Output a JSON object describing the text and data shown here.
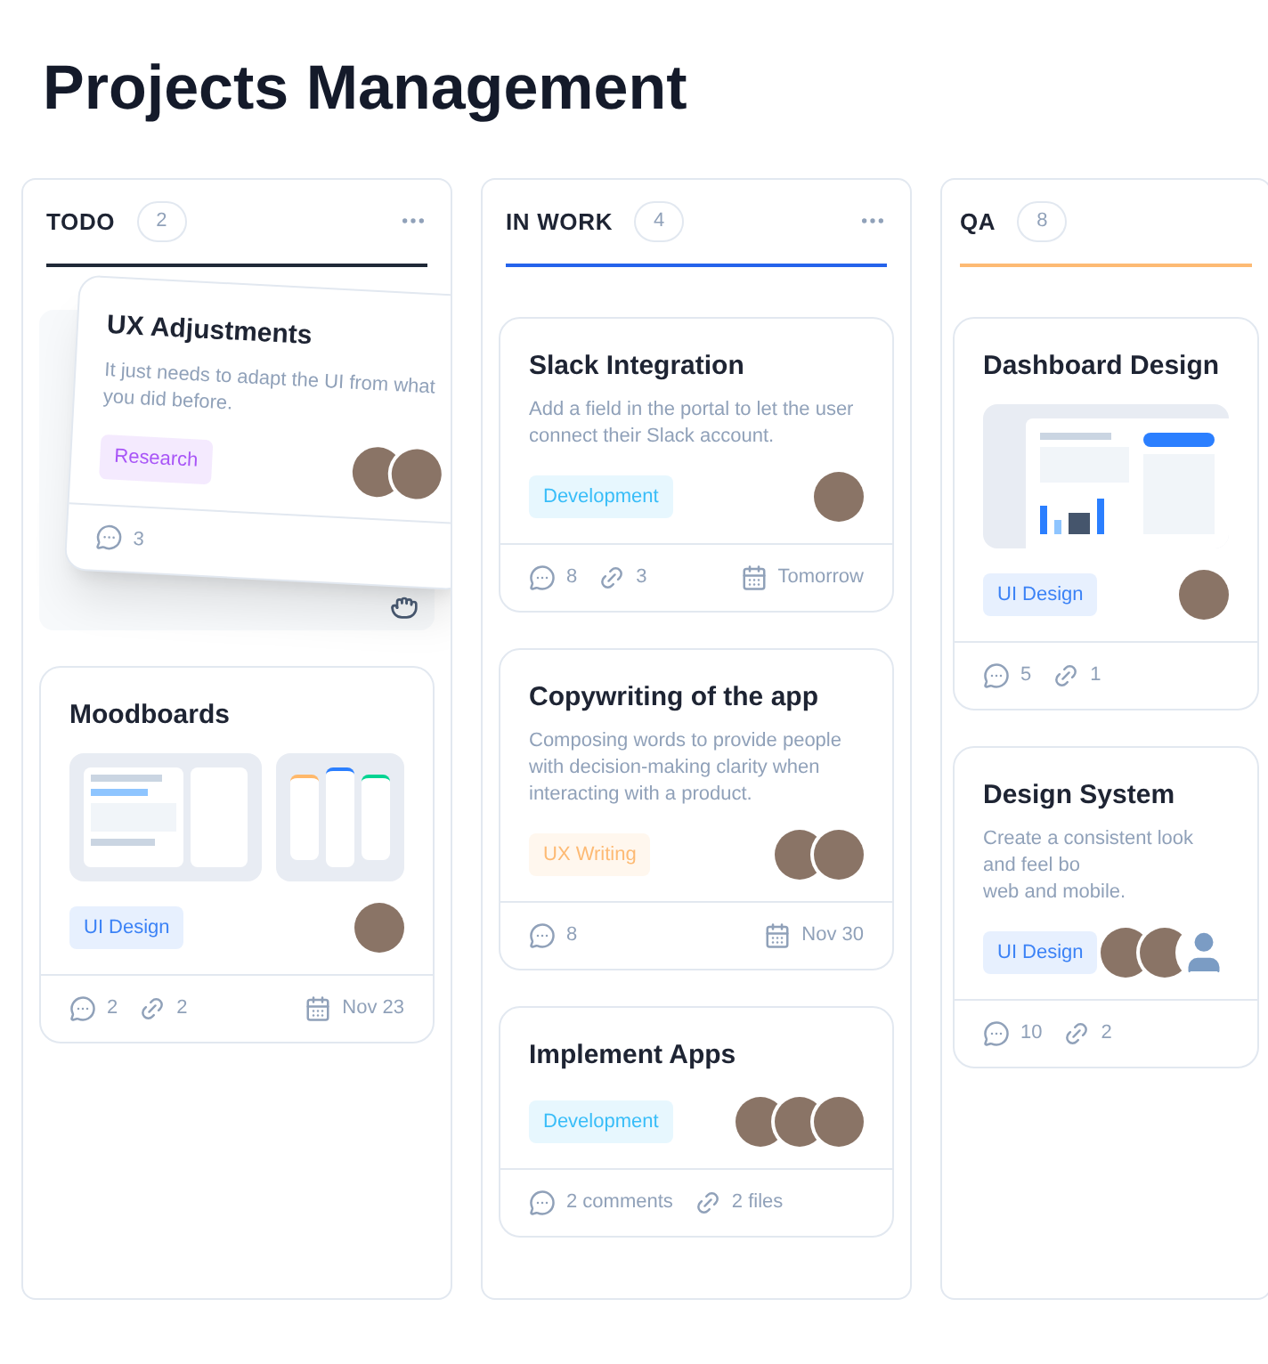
{
  "title": "Projects Management",
  "columns": [
    {
      "name": "TODO",
      "count": "2",
      "color": "#1f2937",
      "cards": [
        {
          "title": "UX Adjustments",
          "dragging": true,
          "description": [
            "It just needs to adapt the UI from what you did before."
          ],
          "tag": {
            "label": "Research",
            "color": "#a855f7"
          },
          "assignees": [
            {
              "kind": "photo"
            },
            {
              "kind": "photo"
            }
          ],
          "stats": [
            {
              "kind": "comments",
              "text": "3"
            }
          ]
        },
        {
          "title": "Moodboards",
          "dragging": false,
          "images": [
            {
              "kind": "desktop"
            },
            {
              "kind": "mobile"
            }
          ],
          "tag": {
            "label": "UI Design",
            "color": "#3b82f6"
          },
          "assignees": [
            {
              "kind": "photo"
            }
          ],
          "stats": [
            {
              "kind": "comments",
              "text": "2"
            },
            {
              "kind": "files",
              "text": "2"
            },
            {
              "kind": "due",
              "text": "Nov 23"
            }
          ]
        }
      ]
    },
    {
      "name": "IN WORK",
      "count": "4",
      "color": "#2563eb",
      "cards": [
        {
          "title": "Slack Integration",
          "dragging": false,
          "description": [
            "Add a field in the portal to let the user connect their Slack account."
          ],
          "tag": {
            "label": "Development",
            "color": "#38bdf8"
          },
          "assignees": [
            {
              "kind": "photo"
            }
          ],
          "stats": [
            {
              "kind": "comments",
              "text": "8"
            },
            {
              "kind": "files",
              "text": "3"
            },
            {
              "kind": "due",
              "text": "Tomorrow"
            }
          ]
        },
        {
          "title": "Copywriting of the app",
          "dragging": false,
          "description": [
            "Composing words to provide people with decision-making clarity when interacting with a product."
          ],
          "tag": {
            "label": "UX Writing",
            "color": "#fdba74"
          },
          "assignees": [
            {
              "kind": "photo"
            },
            {
              "kind": "photo"
            }
          ],
          "stats": [
            {
              "kind": "comments",
              "text": "8"
            },
            {
              "kind": "due",
              "text": "Nov 30"
            }
          ]
        },
        {
          "title": "Implement Apps",
          "dragging": false,
          "tag": {
            "label": "Development",
            "color": "#38bdf8"
          },
          "assignees": [
            {
              "kind": "photo"
            },
            {
              "kind": "photo"
            },
            {
              "kind": "photo"
            }
          ],
          "stats": [
            {
              "kind": "comments",
              "text": "2 comments"
            },
            {
              "kind": "files",
              "text": "2 files"
            }
          ]
        }
      ]
    },
    {
      "name": "QA",
      "count": "8",
      "color": "#fdba74",
      "cards": [
        {
          "title": "Dashboard Design",
          "dragging": false,
          "images": [
            {
              "kind": "dashboard"
            }
          ],
          "tag": {
            "label": "UI Design",
            "color": "#3b82f6"
          },
          "assignees": [
            {
              "kind": "photo"
            }
          ],
          "stats": [
            {
              "kind": "comments",
              "text": "5"
            },
            {
              "kind": "files",
              "text": "1"
            }
          ]
        },
        {
          "title": "Design System",
          "dragging": false,
          "description": [
            "Create a consistent look and feel bo",
            "web and mobile."
          ],
          "tag": {
            "label": "UI Design",
            "color": "#3b82f6"
          },
          "assignees": [
            {
              "kind": "photo"
            },
            {
              "kind": "photo"
            },
            {
              "kind": "silhouette"
            }
          ],
          "stats": [
            {
              "kind": "comments",
              "text": "10"
            },
            {
              "kind": "files",
              "text": "2"
            }
          ]
        }
      ]
    }
  ]
}
